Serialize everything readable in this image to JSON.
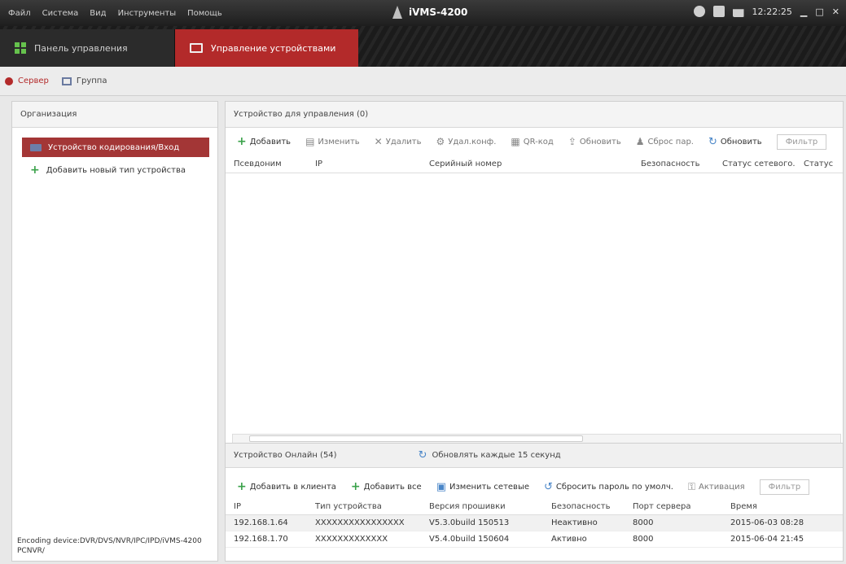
{
  "titlebar": {
    "menus": [
      "Файл",
      "Система",
      "Вид",
      "Инструменты",
      "Помощь"
    ],
    "app_title": "iVMS-4200",
    "time": "12:22:25"
  },
  "module_tabs": [
    {
      "label": "Панель управления",
      "active": false
    },
    {
      "label": "Управление устройствами",
      "active": true
    }
  ],
  "sub_tabs": [
    {
      "label": "Сервер",
      "active": true
    },
    {
      "label": "Группа",
      "active": false
    }
  ],
  "left_panel": {
    "header": "Организация",
    "items": [
      {
        "label": "Устройство кодирования/Вход",
        "selected": true
      },
      {
        "label": "Добавить новый тип устройства",
        "selected": false
      }
    ],
    "footer": "Encoding device:DVR/DVS/NVR/IPC/IPD/iVMS-4200 PCNVR/"
  },
  "managed": {
    "title": "Устройство для управления (0)",
    "toolbar": [
      {
        "icon": "plus-icon",
        "label": "Добавить",
        "enabled": true
      },
      {
        "icon": "edit-icon",
        "label": "Изменить",
        "enabled": false
      },
      {
        "icon": "delete-icon",
        "label": "Удалить",
        "enabled": false
      },
      {
        "icon": "settings-icon",
        "label": "Удал.конф.",
        "enabled": false
      },
      {
        "icon": "qr-icon",
        "label": "QR-код",
        "enabled": false
      },
      {
        "icon": "upgrade-icon",
        "label": "Обновить",
        "enabled": false
      },
      {
        "icon": "user-icon",
        "label": "Сброс пар.",
        "enabled": false
      },
      {
        "icon": "refresh-icon",
        "label": "Обновить",
        "enabled": true
      }
    ],
    "filter_placeholder": "Фильтр",
    "columns": [
      "Псевдоним",
      "IP",
      "Серийный номер",
      "Безопасность",
      "Статус сетевого...",
      "Статус"
    ]
  },
  "online": {
    "title": "Устройство Онлайн (54)",
    "refresh_label": "Обновлять каждые 15 секунд",
    "toolbar": [
      {
        "icon": "plus-icon",
        "label": "Добавить в клиента",
        "enabled": true
      },
      {
        "icon": "plus-icon",
        "label": "Добавить все",
        "enabled": true
      },
      {
        "icon": "network-icon",
        "label": "Изменить сетевые",
        "enabled": true
      },
      {
        "icon": "reset-icon",
        "label": "Сбросить пароль по умолч.",
        "enabled": true
      },
      {
        "icon": "activate-icon",
        "label": "Активация",
        "enabled": false
      }
    ],
    "filter_placeholder": "Фильтр",
    "columns": [
      "IP",
      "Тип устройства",
      "Версия прошивки",
      "Безопасность",
      "Порт сервера",
      "Время"
    ],
    "rows": [
      [
        "192.168.1.64",
        "XXXXXXXXXXXXXXXX",
        "V5.3.0build 150513",
        "Неактивно",
        "8000",
        "2015-06-03 08:28"
      ],
      [
        "192.168.1.70",
        "XXXXXXXXXXXXX",
        "V5.4.0build 150604",
        "Активно",
        "8000",
        "2015-06-04 21:45"
      ]
    ]
  }
}
